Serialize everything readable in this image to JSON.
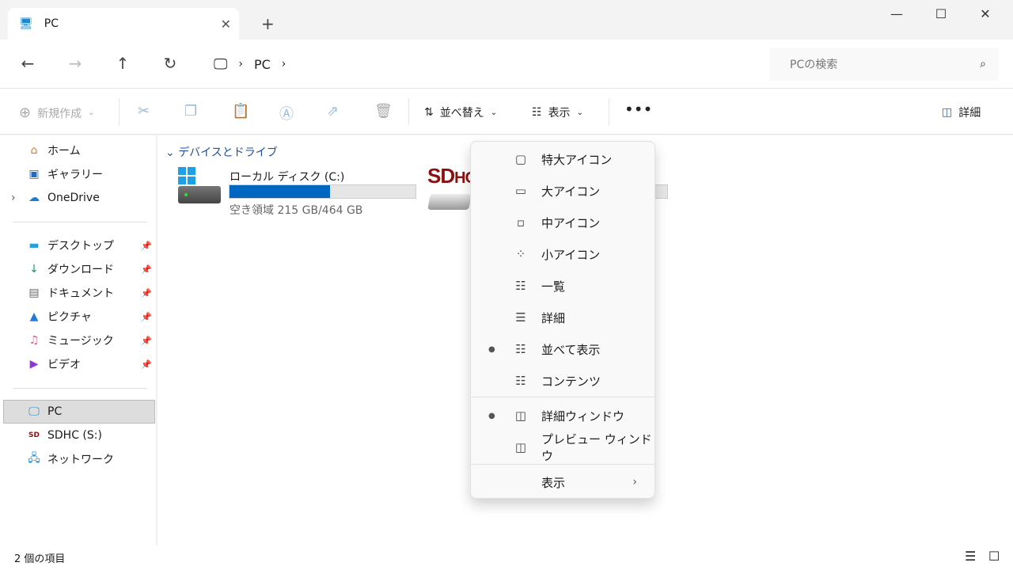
{
  "tab": {
    "title": "PC",
    "icon": "monitor-icon"
  },
  "address": {
    "crumbs": [
      "PC"
    ],
    "search_placeholder": "PCの検索"
  },
  "toolbar": {
    "new": "新規作成",
    "sort": "並べ替え",
    "view": "表示",
    "details": "詳細"
  },
  "sidebar": {
    "top": [
      "ホーム",
      "ギャラリー",
      "OneDrive"
    ],
    "pinned": [
      "デスクトップ",
      "ダウンロード",
      "ドキュメント",
      "ピクチャ",
      "ミュージック",
      "ビデオ"
    ],
    "devices": [
      "PC",
      "SDHC (S:)",
      "ネットワーク"
    ],
    "selected": "PC"
  },
  "content": {
    "group": "デバイスとドライブ",
    "drives": [
      {
        "name": "ローカル ディスク (C:)",
        "free": "空き領域 215 GB/464 GB",
        "used_fraction": 0.54,
        "color": "#0067c0"
      },
      {
        "name": "SDHC (S:)",
        "logo": "SDHC",
        "used_fraction": 0
      }
    ]
  },
  "menu": {
    "items": [
      {
        "label": "特大アイコン",
        "icon": "extra-large-icons-icon",
        "checked": false
      },
      {
        "label": "大アイコン",
        "icon": "large-icons-icon",
        "checked": false
      },
      {
        "label": "中アイコン",
        "icon": "medium-icons-icon",
        "checked": false
      },
      {
        "label": "小アイコン",
        "icon": "small-icons-icon",
        "checked": false
      },
      {
        "label": "一覧",
        "icon": "list-icon",
        "checked": false
      },
      {
        "label": "詳細",
        "icon": "details-icon",
        "checked": false
      },
      {
        "label": "並べて表示",
        "icon": "tiles-icon",
        "checked": true
      },
      {
        "label": "コンテンツ",
        "icon": "content-icon",
        "checked": false
      }
    ],
    "panes": [
      {
        "label": "詳細ウィンドウ",
        "icon": "details-pane-icon",
        "checked": true
      },
      {
        "label": "プレビュー ウィンドウ",
        "icon": "preview-pane-icon",
        "checked": false
      }
    ],
    "submenu": "表示"
  },
  "status": {
    "count": "2 個の項目"
  }
}
